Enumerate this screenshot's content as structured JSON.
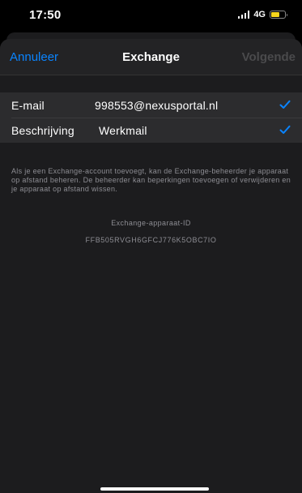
{
  "status_bar": {
    "time": "17:50",
    "network": "4G",
    "battery_level": 0.6,
    "battery_color": "#f7d61c"
  },
  "nav": {
    "cancel_label": "Annuleer",
    "title": "Exchange",
    "next_label": "Volgende"
  },
  "form": {
    "email": {
      "label": "E-mail",
      "value": "998553@nexusportal.nl",
      "icon": "checkmark-icon"
    },
    "description": {
      "label": "Beschrijving",
      "value": "Werkmail",
      "icon": "checkmark-icon"
    }
  },
  "info": {
    "text": "Als je een Exchange-account toevoegt, kan de Exchange-beheerder je apparaat op afstand beheren. De beheerder kan beperkingen toevoegen of verwijderen en je apparaat op afstand wissen.",
    "device_id_label": "Exchange-apparaat-ID",
    "device_id": "FFB505RVGH6GFCJ776K5OBC7IO"
  },
  "colors": {
    "accent": "#0a84ff",
    "disabled": "#4a4a4c",
    "background": "#1c1c1e"
  }
}
